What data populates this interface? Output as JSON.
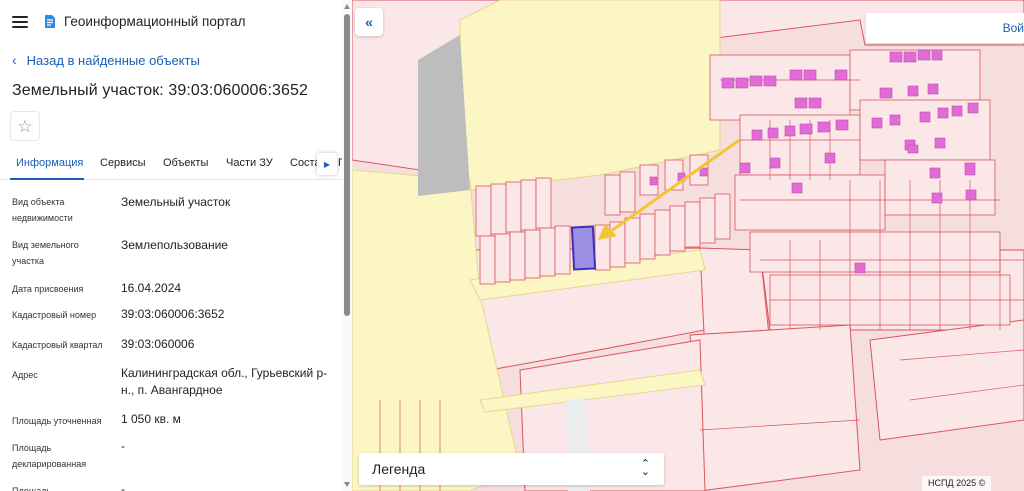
{
  "header": {
    "app_title": "Геоинформационный портал"
  },
  "navigation": {
    "back_label": "Назад в найденные объекты"
  },
  "page": {
    "title": "Земельный участок: 39:03:060006:3652"
  },
  "tabs": [
    {
      "label": "Информация",
      "active": true
    },
    {
      "label": "Сервисы"
    },
    {
      "label": "Объекты"
    },
    {
      "label": "Части ЗУ"
    },
    {
      "label": "Соста"
    },
    {
      "label": "П"
    }
  ],
  "info": [
    {
      "label": "Вид объекта недвижимости",
      "value": "Земельный участок"
    },
    {
      "label": "Вид земельного участка",
      "value": "Землепользование"
    },
    {
      "label": "Дата присвоения",
      "value": "16.04.2024"
    },
    {
      "label": "Кадастровый номер",
      "value": "39:03:060006:3652"
    },
    {
      "label": "Кадастровый квартал",
      "value": "39:03:060006"
    },
    {
      "label": "Адрес",
      "value": "Калининградская обл., Гурьевский р-н., п. Авангардное"
    },
    {
      "label": "Площадь уточненная",
      "value": "1 050 кв. м"
    },
    {
      "label": "Площадь декларированная",
      "value": "-"
    },
    {
      "label": "Площадь",
      "value": "-"
    }
  ],
  "map": {
    "search_button_label": "Вой",
    "legend_label": "Легенда",
    "attribution": "НСПД 2025 ©",
    "colors": {
      "background": "#f6dede",
      "parcel_fill": "#fbe7e7",
      "parcel_line": "#d9565f",
      "yellow_zone": "#fbf6c4",
      "road": "#bdbdbd",
      "building": "#e36bd7",
      "selected_parcel": "#9b8fe3",
      "selected_outline": "#3f2fb8",
      "arrow": "#f3c534"
    }
  },
  "icons": {
    "menu": "hamburger-icon",
    "logo": "portal-logo-icon",
    "back": "chevron-left-icon",
    "favorite": "star-icon",
    "tab_scroll": "chevron-right-icon",
    "collapse": "double-chevron-left-icon",
    "legend_toggle": "chevron-up-down-icon"
  }
}
